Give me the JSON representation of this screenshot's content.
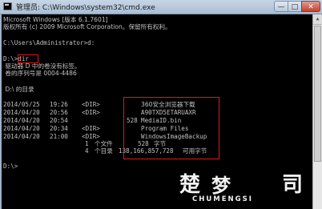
{
  "window": {
    "title": "管理员: C:\\Windows\\system32\\cmd.exe",
    "minimize_label": "—",
    "maximize_label": "□",
    "close_label": "✕"
  },
  "console": {
    "lines": [
      "Microsoft Windows [版本 6.1.7601]",
      "版权所有 (c) 2009 Microsoft Corporation。保留所有权利。",
      "C:\\Users\\Administrator>d:",
      "D:\\>dir",
      " 驱动器 D 中的卷没有标签。",
      " 卷的序列号是 0004-4486",
      " D:\\ 的目录",
      "D:\\>"
    ],
    "entries": [
      {
        "date": "2014/05/25",
        "time": "19:26",
        "type": "<DIR>",
        "size": "",
        "name": "360安全浏览器下载"
      },
      {
        "date": "2014/04/20",
        "time": "20:56",
        "type": "<DIR>",
        "size": "",
        "name": "A90TXD5ETARUAXR"
      },
      {
        "date": "2014/04/20",
        "time": "20:54",
        "type": "",
        "size": "528",
        "name": "MediaID.bin"
      },
      {
        "date": "2014/04/20",
        "time": "20:34",
        "type": "<DIR>",
        "size": "",
        "name": "Program Files"
      },
      {
        "date": "2014/04/20",
        "time": "21:00",
        "type": "<DIR>",
        "size": "",
        "name": "WindowsImageBackup"
      }
    ],
    "summary": {
      "files_count": "1",
      "files_label": "个文件",
      "files_bytes": "528",
      "files_unit": "字节",
      "dirs_count": "4",
      "dirs_label": "个目录",
      "free_bytes": "138,166,857,728",
      "free_label": "可用字节"
    }
  },
  "watermark": {
    "mark_left": "楚",
    "mark_mid": "梦",
    "mark_right": "司",
    "subtitle": "CHUMENGSI"
  }
}
